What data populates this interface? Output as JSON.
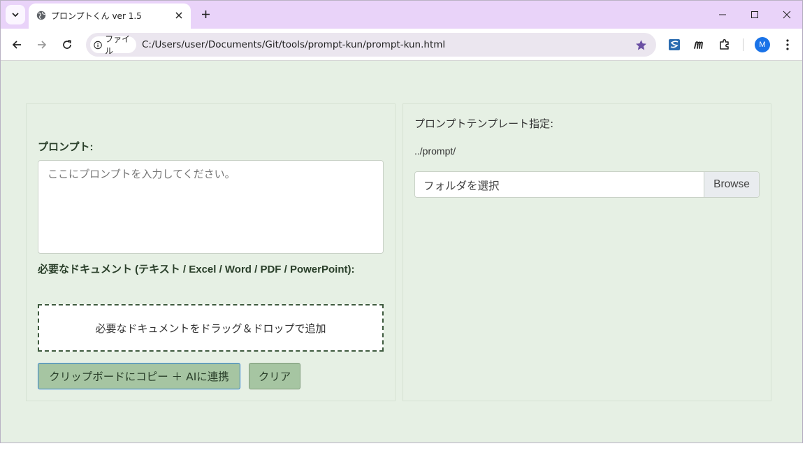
{
  "browser": {
    "tab_title": "プロンプトくん ver 1.5",
    "address_chip_label": "ファイル",
    "url": "C:/Users/user/Documents/Git/tools/prompt-kun/prompt-kun.html",
    "profile_initial": "M",
    "icons": [
      "tab-list-icon",
      "globe-icon",
      "close-icon",
      "plus-icon",
      "minimize-icon",
      "maximize-icon",
      "window-close-icon",
      "back-icon",
      "forward-icon",
      "reload-icon",
      "info-icon",
      "star-icon",
      "extension-s-icon",
      "extension-m-icon",
      "puzzle-icon",
      "more-vert-icon"
    ],
    "accent_color": "#e9d3f9"
  },
  "left_panel": {
    "prompt_label": "プロンプト:",
    "prompt_placeholder": "ここにプロンプトを入力してください。",
    "documents_label": "必要なドキュメント (テキスト / Excel / Word / PDF / PowerPoint):",
    "drop_zone_text": "必要なドキュメントをドラッグ＆ドロップで追加",
    "copy_button": "クリップボードにコピー ＋ AIに連携",
    "clear_button": "クリア"
  },
  "right_panel": {
    "template_label": "プロンプトテンプレート指定:",
    "template_path": "../prompt/",
    "folder_placeholder": "フォルダを選択",
    "browse_button": "Browse"
  },
  "colors": {
    "page_background": "#e6f0e4",
    "button_background": "#a6c5a2",
    "focus_border": "#2d7fcf"
  }
}
